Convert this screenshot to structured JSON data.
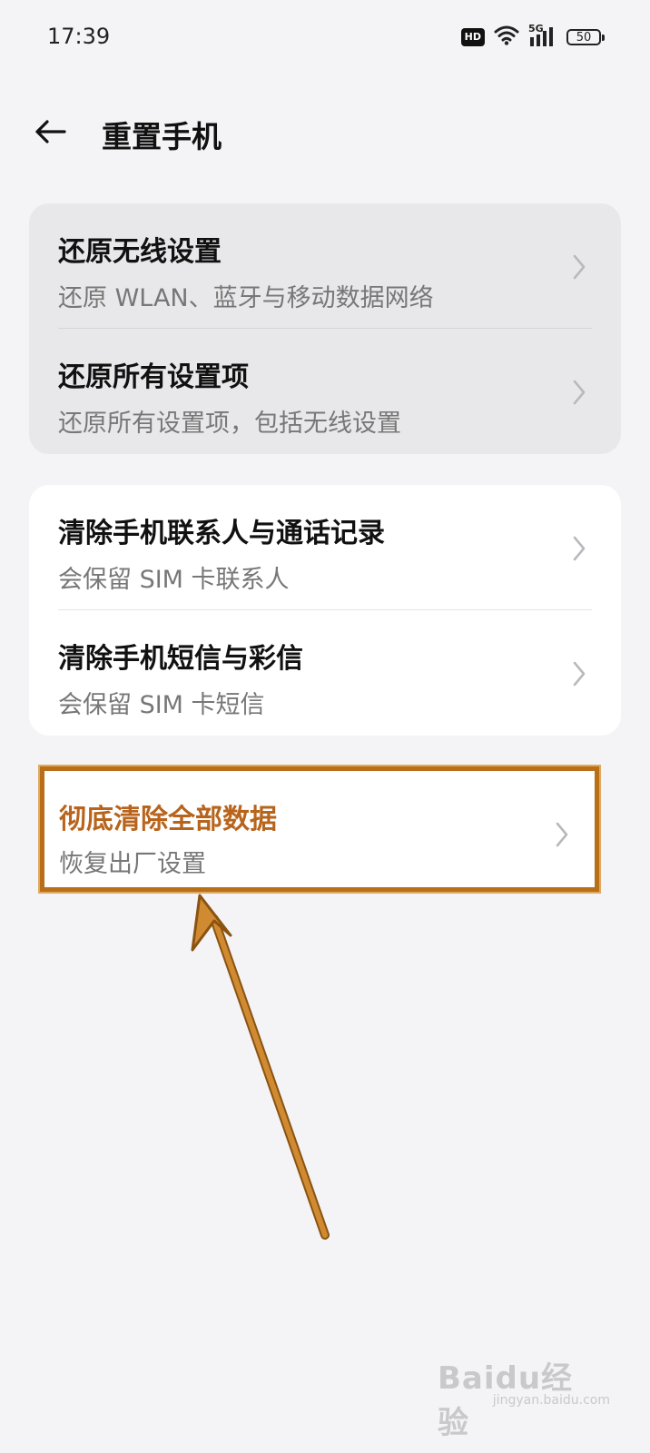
{
  "status_bar": {
    "time": "17:39",
    "hd_label": "HD",
    "network_label": "5G",
    "battery_level": "50"
  },
  "header": {
    "title": "重置手机"
  },
  "groups": [
    {
      "items": [
        {
          "title": "还原无线设置",
          "subtitle": "还原 WLAN、蓝牙与移动数据网络"
        },
        {
          "title": "还原所有设置项",
          "subtitle": "还原所有设置项，包括无线设置"
        }
      ]
    },
    {
      "items": [
        {
          "title": "清除手机联系人与通话记录",
          "subtitle": "会保留 SIM 卡联系人"
        },
        {
          "title": "清除手机短信与彩信",
          "subtitle": "会保留 SIM 卡短信"
        }
      ]
    },
    {
      "items": [
        {
          "title": "彻底清除全部数据",
          "subtitle": "恢复出厂设置"
        }
      ]
    }
  ],
  "watermark": {
    "logo": "Baidu经验",
    "url": "jingyan.baidu.com"
  },
  "colors": {
    "background": "#f4f4f6",
    "highlight_border": "#b96f17",
    "highlight_title": "#b8641c",
    "annotation_arrow": "#c27a24"
  }
}
